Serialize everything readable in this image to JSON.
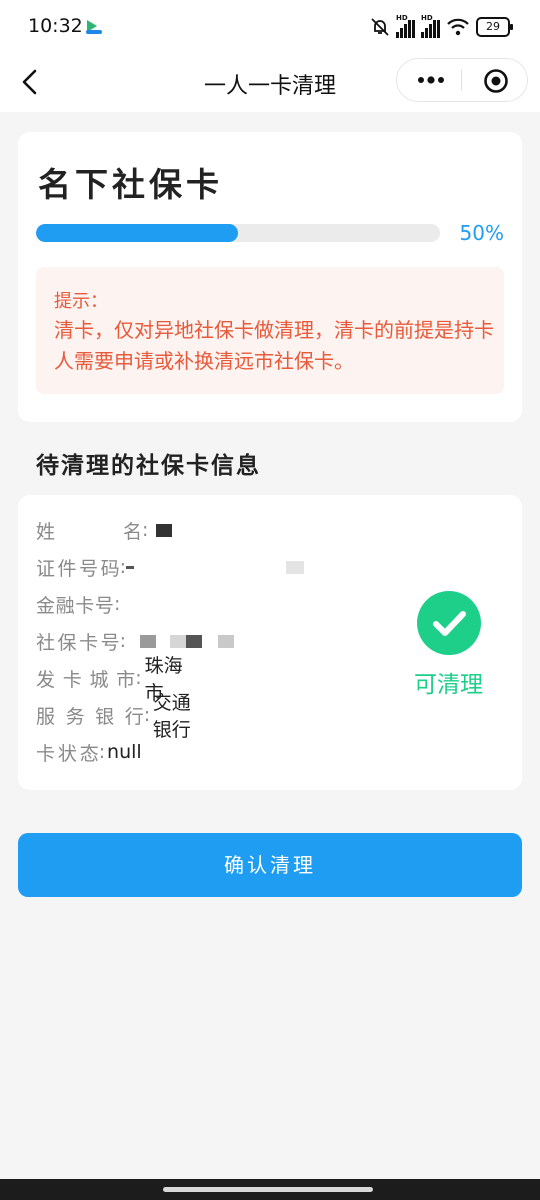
{
  "status_bar": {
    "time": "10:32",
    "net1_label": "HD",
    "net2_label": "HD",
    "battery": "29",
    "icons": [
      "app-icon",
      "mute-bell-icon",
      "signal-icon",
      "signal-icon",
      "wifi-icon",
      "battery-icon"
    ]
  },
  "nav": {
    "title": "一人一卡清理",
    "icons": [
      "back-icon",
      "more-icon",
      "close-target-icon"
    ]
  },
  "summary_card": {
    "title": "名下社保卡",
    "progress_percent": 50,
    "progress_text": "50%",
    "tip_title": "提示：",
    "tip_body": "清卡，仅对异地社保卡做清理，清卡的前提是持卡人需要申请或补换清远市社保卡。"
  },
  "section": {
    "title": "待清理的社保卡信息"
  },
  "info": {
    "rows": [
      {
        "label": "姓名",
        "value": ""
      },
      {
        "label": "证件号码",
        "value": ""
      },
      {
        "label": "金融卡号",
        "value": ""
      },
      {
        "label": "社保卡号",
        "value": ""
      },
      {
        "label": "发卡城市",
        "value": "珠海市"
      },
      {
        "label": "服务银行",
        "value": "交通银行"
      },
      {
        "label": "卡状态",
        "value": "null"
      }
    ],
    "colon": ":",
    "status_text": "可清理",
    "status_icon": "check-circle-icon"
  },
  "actions": {
    "confirm_label": "确认清理"
  },
  "colors": {
    "primary": "#1e9df2",
    "success": "#1ecf8a",
    "warning_text": "#e85a3a",
    "warning_bg": "#fdf3f0"
  }
}
